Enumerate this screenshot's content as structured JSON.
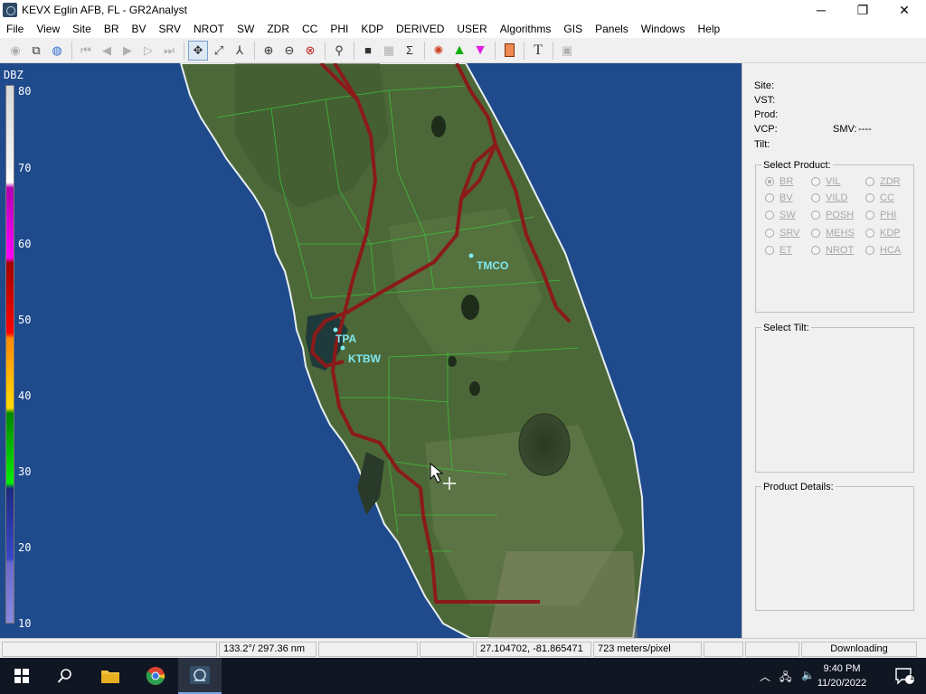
{
  "window": {
    "title": "KEVX Eglin AFB, FL - GR2Analyst",
    "minimize": "─",
    "maximize": "❐",
    "close": "✕"
  },
  "menu": [
    "File",
    "View",
    "Site",
    "BR",
    "BV",
    "SRV",
    "NROT",
    "SW",
    "ZDR",
    "CC",
    "PHI",
    "KDP",
    "DERIVED",
    "USER",
    "Algorithms",
    "GIS",
    "Panels",
    "Windows",
    "Help"
  ],
  "toolbar": {
    "icons": [
      "radar-icon",
      "copy-windows-icon",
      "globe-icon",
      "first-frame-icon",
      "prev-frame-icon",
      "play-icon",
      "next-frame-icon",
      "last-frame-icon",
      "pan-icon",
      "measure-icon",
      "cross-section-icon",
      "zoom-in-icon",
      "zoom-out-icon",
      "zoom-reset-icon",
      "link-icon",
      "storm-relative-icon",
      "grid-icon",
      "sigma-icon",
      "hurricane-icon",
      "green-triangle-icon",
      "magenta-triangle-icon",
      "orange-rect-icon",
      "text-icon",
      "frame-icon"
    ]
  },
  "colorbar": {
    "unit": "DBZ",
    "ticks": [
      "80",
      "70",
      "60",
      "50",
      "40",
      "30",
      "20",
      "10"
    ]
  },
  "map_labels": {
    "tmco": "TMCO",
    "tpa": "TPA",
    "ktbw": "KTBW"
  },
  "info": {
    "site_label": "Site:",
    "vst_label": "VST:",
    "prod_label": "Prod:",
    "vcp_label": "VCP:",
    "smv_label": "SMV:",
    "smv_value": "----",
    "tilt_label": "Tilt:"
  },
  "select_product": {
    "title": "Select Product:",
    "options": [
      {
        "label": "BR",
        "selected": true
      },
      {
        "label": "VIL"
      },
      {
        "label": "ZDR"
      },
      {
        "label": "BV"
      },
      {
        "label": "VILD"
      },
      {
        "label": "CC"
      },
      {
        "label": "SW"
      },
      {
        "label": "POSH"
      },
      {
        "label": "PHI"
      },
      {
        "label": "SRV"
      },
      {
        "label": "MEHS"
      },
      {
        "label": "KDP"
      },
      {
        "label": "ET"
      },
      {
        "label": "NROT"
      },
      {
        "label": "HCA"
      }
    ]
  },
  "select_tilt": {
    "title": "Select Tilt:"
  },
  "product_details": {
    "title": "Product Details:"
  },
  "status": {
    "azimuth_range": "133.2°/ 297.36 nm",
    "lat_lon": "27.104702, -81.865471",
    "scale": "723 meters/pixel",
    "state": "Downloading"
  },
  "taskbar": {
    "time": "9:40 PM",
    "date": "11/20/2022",
    "notifications": "1"
  },
  "colors": {
    "water": "#1f4a8c",
    "land": "#4e6a3a",
    "roads": "#8b1a1a",
    "county_lines": "#3ccc3c",
    "label": "#7fe8f0"
  }
}
